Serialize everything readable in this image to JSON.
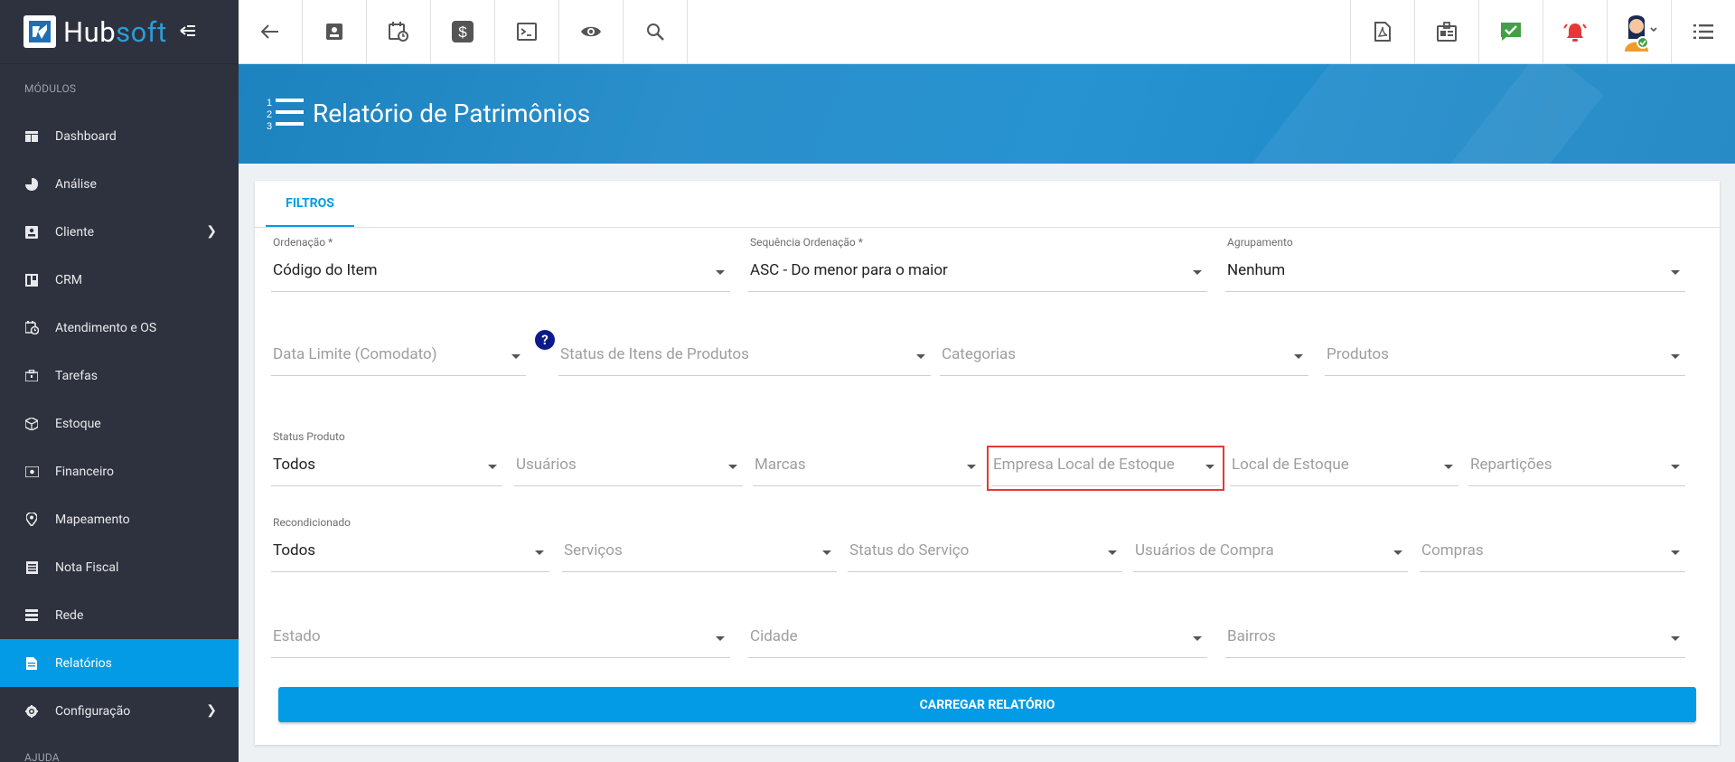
{
  "app": {
    "logo_main": "Hub",
    "logo_accent": "soft"
  },
  "sidebar": {
    "section_modules": "MÓDULOS",
    "section_help": "AJUDA",
    "items": [
      {
        "label": "Dashboard",
        "icon": "dashboard-icon"
      },
      {
        "label": "Análise",
        "icon": "pie-chart-icon"
      },
      {
        "label": "Cliente",
        "icon": "contact-card-icon"
      },
      {
        "label": "CRM",
        "icon": "crm-icon"
      },
      {
        "label": "Atendimento e OS",
        "icon": "calendar-clock-icon"
      },
      {
        "label": "Tarefas",
        "icon": "briefcase-icon"
      },
      {
        "label": "Estoque",
        "icon": "box-icon"
      },
      {
        "label": "Financeiro",
        "icon": "money-icon"
      },
      {
        "label": "Mapeamento",
        "icon": "map-pin-icon"
      },
      {
        "label": "Nota Fiscal",
        "icon": "document-list-icon"
      },
      {
        "label": "Rede",
        "icon": "network-icon"
      },
      {
        "label": "Relatórios",
        "icon": "report-icon"
      },
      {
        "label": "Configuração",
        "icon": "gear-icon"
      }
    ]
  },
  "page": {
    "title": "Relatório de Patrimônios"
  },
  "tabs": {
    "filtros": "FILTROS"
  },
  "filters": {
    "ordenacao": {
      "label": "Ordenação *",
      "value": "Código do Item"
    },
    "sequencia": {
      "label": "Sequência Ordenação *",
      "value": "ASC - Do menor para o maior"
    },
    "agrupamento": {
      "label": "Agrupamento",
      "value": "Nenhum"
    },
    "data_limite": {
      "placeholder": "Data Limite (Comodato)"
    },
    "status_itens": {
      "placeholder": "Status de Itens de Produtos"
    },
    "categorias": {
      "placeholder": "Categorias"
    },
    "produtos": {
      "placeholder": "Produtos"
    },
    "status_produto": {
      "label": "Status Produto",
      "value": "Todos"
    },
    "usuarios": {
      "placeholder": "Usuários"
    },
    "marcas": {
      "placeholder": "Marcas"
    },
    "empresa_local": {
      "placeholder": "Empresa Local de Estoque"
    },
    "local_estoque": {
      "placeholder": "Local de Estoque"
    },
    "reparticoes": {
      "placeholder": "Repartições"
    },
    "recondicionado": {
      "label": "Recondicionado",
      "value": "Todos"
    },
    "servicos": {
      "placeholder": "Serviços"
    },
    "status_servico": {
      "placeholder": "Status do Serviço"
    },
    "usuarios_compra": {
      "placeholder": "Usuários de Compra"
    },
    "compras": {
      "placeholder": "Compras"
    },
    "estado": {
      "placeholder": "Estado"
    },
    "cidade": {
      "placeholder": "Cidade"
    },
    "bairros": {
      "placeholder": "Bairros"
    }
  },
  "help": {
    "symbol": "?"
  },
  "actions": {
    "load_report": "CARREGAR RELATÓRIO"
  },
  "colors": {
    "accent": "#039be5",
    "sidebar": "#2d323e",
    "highlight": "#e53935",
    "notif_green": "#43a047",
    "notif_red": "#e53935"
  }
}
